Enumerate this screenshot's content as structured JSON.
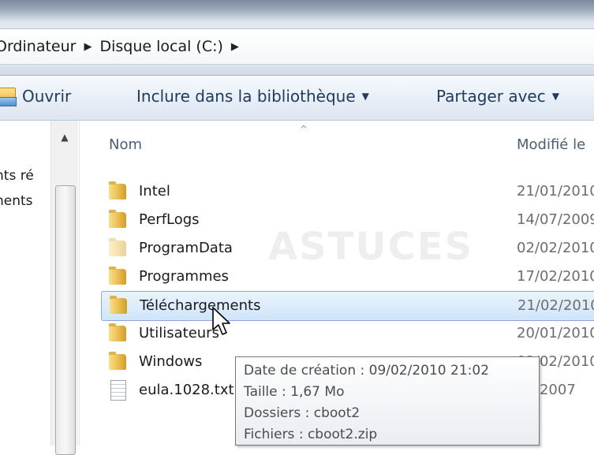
{
  "address": {
    "crumbs": [
      "Ordinateur",
      "Disque local (C:)"
    ],
    "separator": "▶"
  },
  "toolbar": {
    "open_label": "Ouvrir",
    "include_label": "Inclure dans la bibliothèque",
    "share_label": "Partager avec",
    "caret": "▼"
  },
  "nav": {
    "items": [
      "nts ré",
      "nents"
    ],
    "scroll_up": "▲"
  },
  "columns": {
    "name": "Nom",
    "date": "Modifié le",
    "sort_indicator": "^"
  },
  "files": [
    {
      "name": "Intel",
      "date": "21/01/2010",
      "type": "folder"
    },
    {
      "name": "PerfLogs",
      "date": "14/07/2009",
      "type": "folder"
    },
    {
      "name": "ProgramData",
      "date": "02/02/2010",
      "type": "folder-hidden"
    },
    {
      "name": "Programmes",
      "date": "17/02/2010",
      "type": "folder"
    },
    {
      "name": "Téléchargements",
      "date": "21/02/2010",
      "type": "folder",
      "selected": true
    },
    {
      "name": "Utilisateurs",
      "date": "20/01/2010",
      "type": "folder"
    },
    {
      "name": "Windows",
      "date": "02/02/2010",
      "type": "folder"
    },
    {
      "name": "eula.1028.txt",
      "date": "11/2007",
      "type": "text"
    }
  ],
  "tooltip": {
    "lines": [
      "Date de création : 09/02/2010 21:02",
      "Taille : 1,67 Mo",
      "Dossiers : cboot2",
      "Fichiers : cboot2.zip"
    ]
  },
  "watermark": "ASTUCES"
}
